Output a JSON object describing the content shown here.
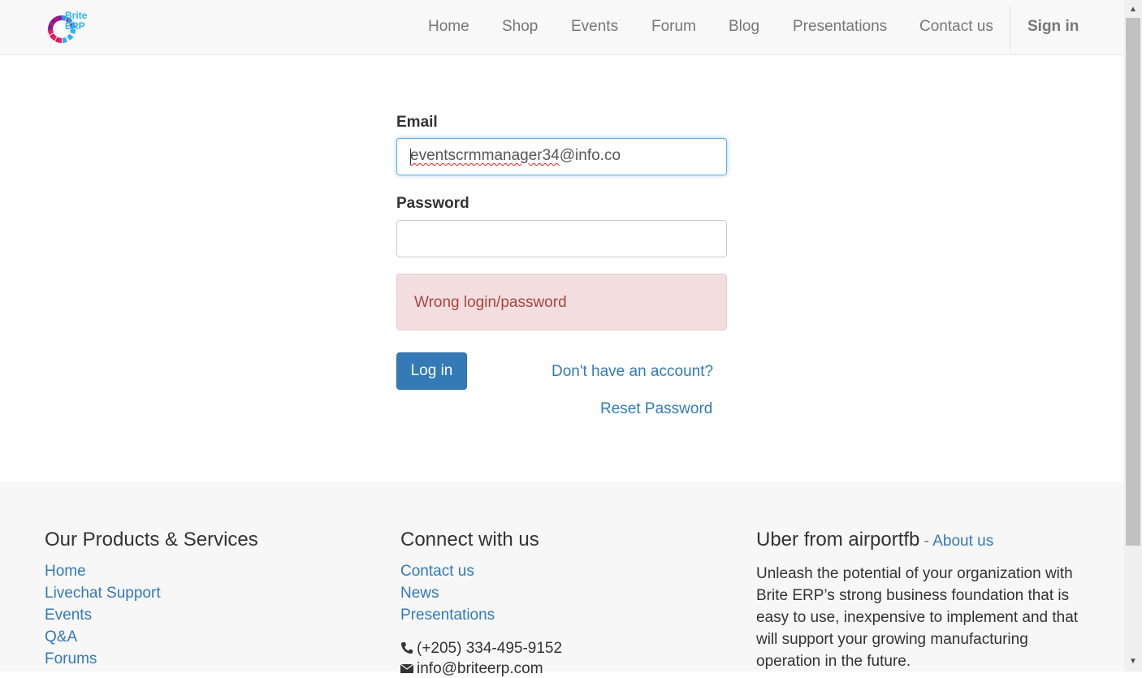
{
  "navbar": {
    "logo_text": "Brite ERP",
    "items": [
      {
        "label": "Home"
      },
      {
        "label": "Shop"
      },
      {
        "label": "Events"
      },
      {
        "label": "Forum"
      },
      {
        "label": "Blog"
      },
      {
        "label": "Presentations"
      },
      {
        "label": "Contact us"
      }
    ],
    "signin_label": "Sign in"
  },
  "login": {
    "email_label": "Email",
    "email_value": "eventscrmmanager34@info.co",
    "email_misspelled_part": "eventscrmmanager34",
    "email_rest_part": "@info.co",
    "password_label": "Password",
    "password_value": "",
    "error_message": "Wrong login/password",
    "login_button": "Log in",
    "signup_link": "Don't have an account?",
    "reset_link": "Reset Password"
  },
  "footer": {
    "products": {
      "heading": "Our Products & Services",
      "links": [
        "Home",
        "Livechat Support",
        "Events",
        "Q&A",
        "Forums"
      ]
    },
    "connect": {
      "heading": "Connect with us",
      "links": [
        "Contact us",
        "News",
        "Presentations"
      ],
      "phone": "(+205) 334-495-9152",
      "email": "info@briteerp.com"
    },
    "about": {
      "heading": "Uber from airportfb",
      "separator": " - ",
      "about_link": "About us",
      "text": "Unleash the potential of your organization with Brite ERP’s strong business foundation that is easy to use, inexpensive to implement and that will support your growing manufacturing operation in the future."
    }
  },
  "colors": {
    "link": "#337ab7",
    "primary_button": "#337ab7",
    "alert_bg": "#f2dede",
    "alert_text": "#a94442",
    "nav_bg": "#f8f8f8",
    "footer_bg": "#f7f7f7"
  }
}
